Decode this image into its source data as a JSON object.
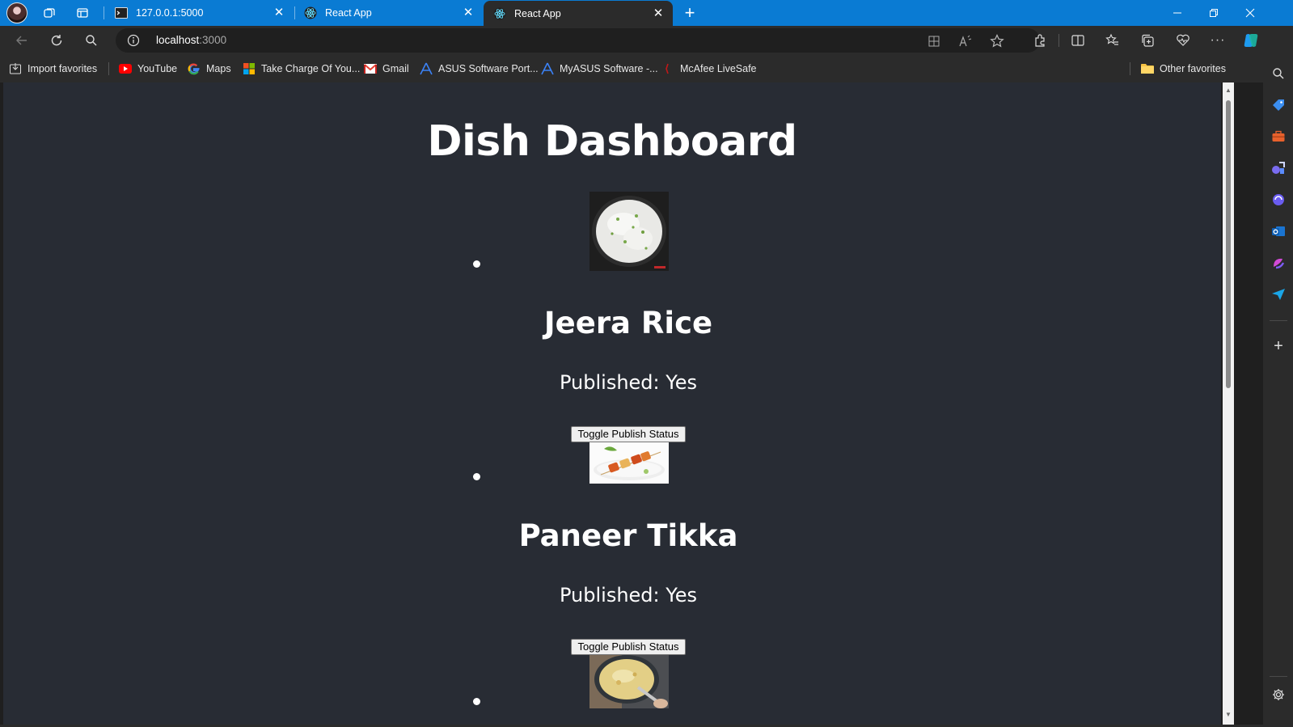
{
  "tabs": [
    {
      "title": "127.0.0.1:5000",
      "favicon": "terminal-icon",
      "active": false
    },
    {
      "title": "React App",
      "favicon": "react-icon",
      "active": false
    },
    {
      "title": "React App",
      "favicon": "react-icon",
      "active": true
    }
  ],
  "address_bar": {
    "host": "localhost",
    "port": ":3000"
  },
  "favorites": [
    {
      "label": "Import favorites",
      "icon": "import-icon"
    },
    {
      "label": "YouTube",
      "icon": "youtube-icon"
    },
    {
      "label": "Maps",
      "icon": "google-icon"
    },
    {
      "label": "Take Charge Of You...",
      "icon": "windows-icon"
    },
    {
      "label": "Gmail",
      "icon": "gmail-icon"
    },
    {
      "label": "ASUS Software Port...",
      "icon": "asus-icon"
    },
    {
      "label": "MyASUS Software -...",
      "icon": "asus-icon"
    },
    {
      "label": "McAfee LiveSafe",
      "icon": "mcafee-icon"
    },
    {
      "label": "Other favorites",
      "icon": "folder-icon"
    }
  ],
  "page": {
    "title": "Dish Dashboard",
    "toggle_label": "Toggle Publish Status",
    "dishes": [
      {
        "name": "Jeera Rice",
        "published": "Published: Yes",
        "image": "rice-plate"
      },
      {
        "name": "Paneer Tikka",
        "published": "Published: Yes",
        "image": "paneer-tikka-plate"
      },
      {
        "name": "",
        "published": "",
        "image": "curry-bowl"
      }
    ]
  },
  "colors": {
    "titlebar": "#0a7bd3",
    "chrome": "#2b2b2b",
    "page_background": "#282c34",
    "text": "#ffffff"
  }
}
